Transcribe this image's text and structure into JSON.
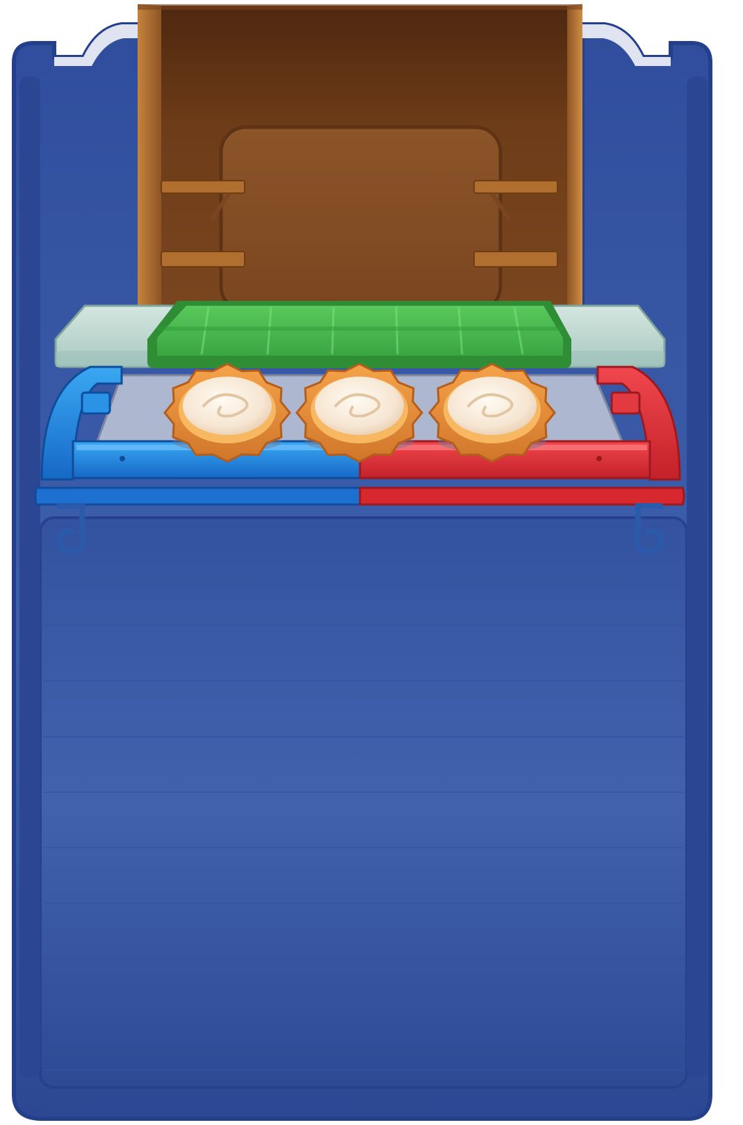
{
  "scene": {
    "name": "pastry-display-stand",
    "colors": {
      "board_blue": "#3a5aa6",
      "board_blue_dark": "#20377e",
      "board_blue_light": "#4a6ab6",
      "cabinet_wood": "#a2622a",
      "cabinet_interior": "#6a3a18",
      "cabinet_panel": "#8b5128",
      "shelf_wood": "#b8742f",
      "counter_top": "#c4dbd4",
      "counter_edge": "#8db1aa",
      "green_mat": "#46b64c",
      "green_mat_light": "#6bd76f",
      "tray_left_blue": "#1d86e0",
      "tray_right_red": "#e03038",
      "tray_surface": "#aeb7d0",
      "tart_crust": "#e08a34",
      "tart_cream": "#fbf1e4"
    }
  },
  "tray": {
    "tarts": [
      {
        "id": "tart-1",
        "type": "cream-tart"
      },
      {
        "id": "tart-2",
        "type": "cream-tart"
      },
      {
        "id": "tart-3",
        "type": "cream-tart"
      }
    ]
  }
}
